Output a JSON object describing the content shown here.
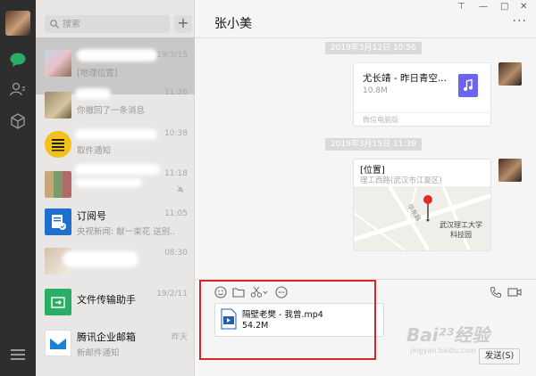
{
  "window": {
    "controls": [
      "⊤",
      "—",
      "□",
      "✕"
    ]
  },
  "search": {
    "placeholder": "搜索"
  },
  "list": {
    "add_label": "+",
    "chats": [
      {
        "name": "",
        "preview": "[地理位置]",
        "time": "19/3/15",
        "active": true
      },
      {
        "name": "",
        "preview": "你撤回了一条消息",
        "time": "11:26"
      },
      {
        "name": "",
        "preview": "取件通知",
        "time": "10:38"
      },
      {
        "name": "",
        "preview": "",
        "time": "11:18"
      },
      {
        "name": "订阅号",
        "preview": "央视新闻: 献一束花 送别...",
        "time": "11:05"
      },
      {
        "name": "",
        "preview": "",
        "time": "08:30"
      },
      {
        "name": "文件传输助手",
        "preview": "",
        "time": "19/2/11"
      },
      {
        "name": "腾讯企业邮箱",
        "preview": "新邮件通知",
        "time": "昨天"
      }
    ]
  },
  "conversation": {
    "title": "张小美",
    "more_label": "···",
    "messages": [
      {
        "timestamp": "2019年3月12日 10:56",
        "file_name": "尤长靖 - 昨日青空...",
        "file_size": "10.8M",
        "file_source": "微信电脑版"
      },
      {
        "timestamp": "2019年3月15日 11:39",
        "loc_title": "[位置]",
        "loc_address": "理工西路(武汉市江夏区)",
        "map_road": "华东路",
        "map_place": "武汉理工大学科技园"
      }
    ]
  },
  "composer": {
    "attachment_name": "隔壁老樊 - 我曾.mp4",
    "attachment_size": "54.2M",
    "send_label": "发送(S)"
  },
  "watermark": {
    "main": "Bai²³经验",
    "sub": "jingyan.baidu.com"
  },
  "colors": {
    "rail": "#2e2e2e",
    "list": "#e8e7e6",
    "active": "#c9c8c7",
    "wechat_green": "#2aae67",
    "highlight": "#d8262a"
  }
}
